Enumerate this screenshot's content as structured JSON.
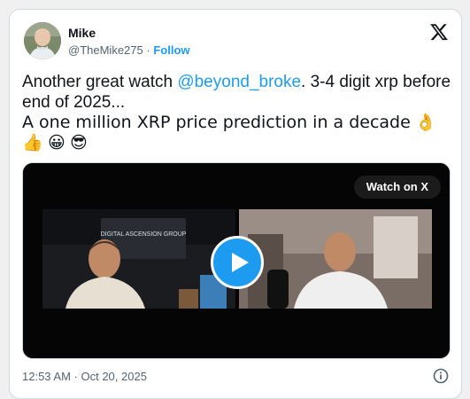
{
  "author": {
    "name": "Mike",
    "handle": "@TheMike275",
    "separator": "·",
    "follow_label": "Follow"
  },
  "tweet": {
    "text_before_mention": "Another great watch ",
    "mention": "@beyond_broke",
    "text_after_mention": ". 3-4 digit xrp before end of 2025...",
    "line2": "A one million XRP price prediction in a decade",
    "emojis": [
      "👌",
      "👍",
      "😀",
      "😎"
    ]
  },
  "media": {
    "watch_label": "Watch on X",
    "sign_text": "DIGITAL ASCENSION GROUP"
  },
  "footer": {
    "timestamp": "12:53 AM · Oct 20, 2025"
  },
  "colors": {
    "accent": "#1d9bf0",
    "text": "#0f1419",
    "muted": "#536471"
  },
  "icons": {
    "logo": "x-logo-icon",
    "play": "play-icon",
    "info": "info-icon"
  }
}
